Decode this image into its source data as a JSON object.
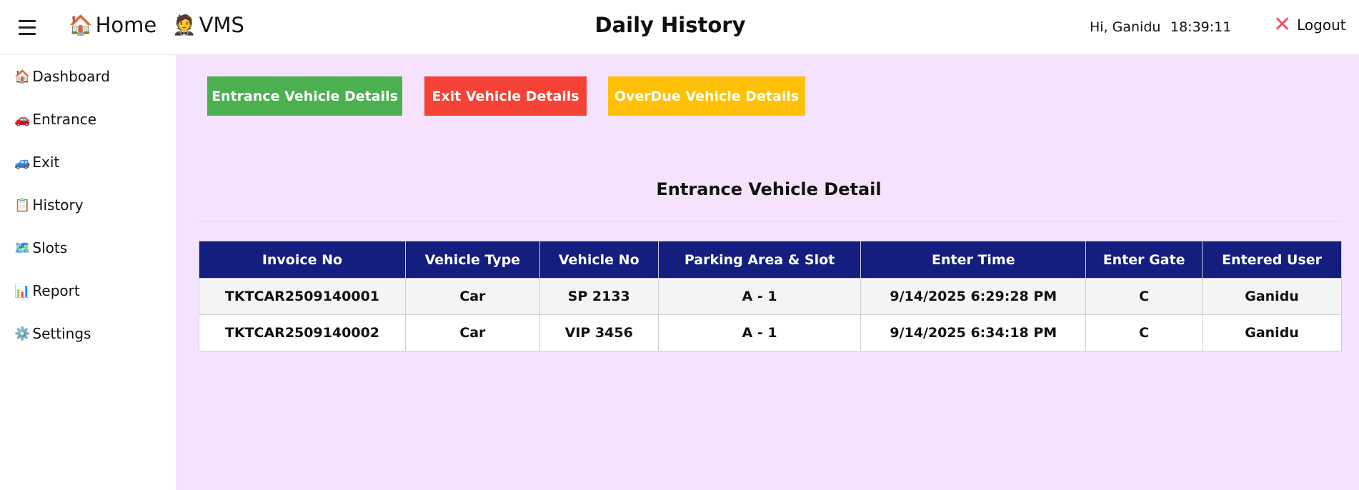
{
  "topbar": {
    "home_icon": "🏠",
    "home_label": "Home",
    "vms_icon": "🤵",
    "vms_label": "VMS",
    "title": "Daily History",
    "greeting": "Hi, Ganidu",
    "clock": "18:39:11",
    "logout_icon": "✕",
    "logout_label": "Logout"
  },
  "sidebar": {
    "items": [
      {
        "icon": "🏠",
        "label": "Dashboard"
      },
      {
        "icon": "🚗",
        "label": "Entrance"
      },
      {
        "icon": "🚙",
        "label": "Exit"
      },
      {
        "icon": "📋",
        "label": "History"
      },
      {
        "icon": "🗺️",
        "label": "Slots"
      },
      {
        "icon": "📊",
        "label": "Report"
      },
      {
        "icon": "⚙️",
        "label": "Settings"
      }
    ]
  },
  "buttons": {
    "entrance": "Entrance Vehicle Details",
    "exit": "Exit Vehicle Details",
    "overdue": "OverDue Vehicle Details"
  },
  "colors": {
    "entrance_button": "#4caf50",
    "exit_button": "#f44336",
    "overdue_button": "#ffc107",
    "table_header": "#131e7e",
    "main_background": "#f5e3fd"
  },
  "section": {
    "title": "Entrance Vehicle Detail"
  },
  "table": {
    "headers": [
      "Invoice No",
      "Vehicle Type",
      "Vehicle No",
      "Parking Area & Slot",
      "Enter Time",
      "Enter Gate",
      "Entered User"
    ],
    "rows": [
      [
        "TKTCAR2509140001",
        "Car",
        "SP 2133",
        "A - 1",
        "9/14/2025 6:29:28 PM",
        "C",
        "Ganidu"
      ],
      [
        "TKTCAR2509140002",
        "Car",
        "VIP 3456",
        "A - 1",
        "9/14/2025 6:34:18 PM",
        "C",
        "Ganidu"
      ]
    ]
  }
}
